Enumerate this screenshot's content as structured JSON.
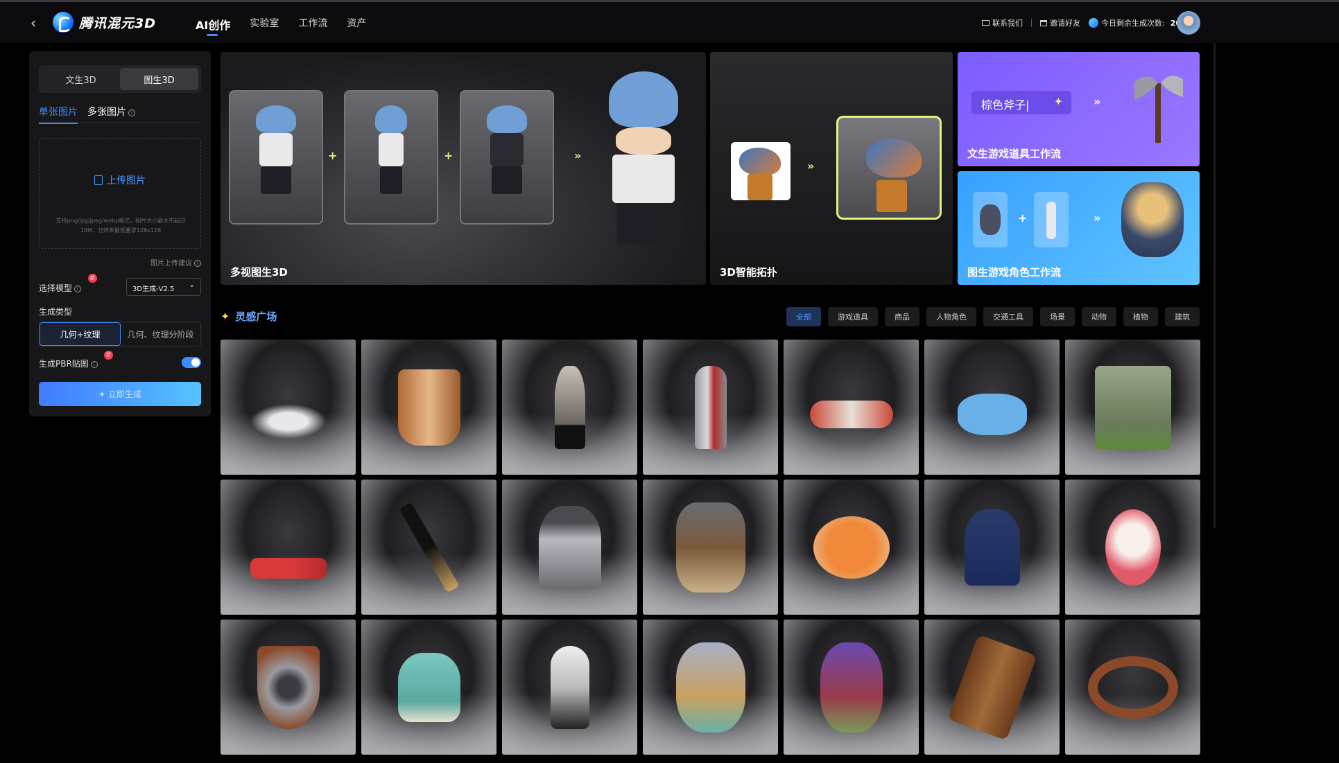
{
  "header": {
    "brand": "腾讯混元3D",
    "nav": [
      "AI创作",
      "实验室",
      "工作流",
      "资产"
    ],
    "contact": "联系我们",
    "invite": "邀请好友",
    "credits_label": "今日剩余生成次数:",
    "credits_value": "20"
  },
  "panel": {
    "mode_tabs": [
      "文生3D",
      "图生3D"
    ],
    "active_mode": "图生3D",
    "sub_tabs": [
      "单张图片",
      "多张图片"
    ],
    "upload_label": "上传图片",
    "upload_hint": "支持png/jpg/jpeg/webp格式，图片大小最大不超过10M，分辨率最低要求128x128",
    "upload_tips": "图片上传建议",
    "model_label": "选择模型",
    "model_value": "3D生成-V2.5",
    "new_badge": "新",
    "gen_type_label": "生成类型",
    "gen_types": [
      "几何+纹理",
      "几何、纹理分阶段"
    ],
    "pbr_label": "生成PBR贴图",
    "pbr_enabled": true,
    "generate_button": "✦ 立即生成"
  },
  "banners": {
    "multiview_title": "多视图生3D",
    "topology_title": "3D智能拓扑",
    "prop_title": "文生游戏道具工作流",
    "prop_prompt": "棕色斧子|",
    "character_title": "图生游戏角色工作流",
    "plus": "+",
    "arrows": "»"
  },
  "gallery": {
    "title": "灵感广场",
    "filters": [
      "全部",
      "游戏道具",
      "商品",
      "人物角色",
      "交通工具",
      "场景",
      "动物",
      "植物",
      "建筑"
    ],
    "active_filter": "全部",
    "items": [
      "scorpion-model",
      "copper-mug-model",
      "horse-chess-model",
      "knight-model",
      "airplane-model",
      "brush-model",
      "temple-model",
      "saucepan-model",
      "fountain-pen-model",
      "soldier-model",
      "bear-warrior-model",
      "crab-model",
      "spiderman-bust-model",
      "bunny-daruma-model",
      "shield-model",
      "teacup-model",
      "astronaut-model",
      "hedgehog-king-model",
      "purple-monster-model",
      "wooden-tray-model",
      "leather-collar-model"
    ]
  }
}
